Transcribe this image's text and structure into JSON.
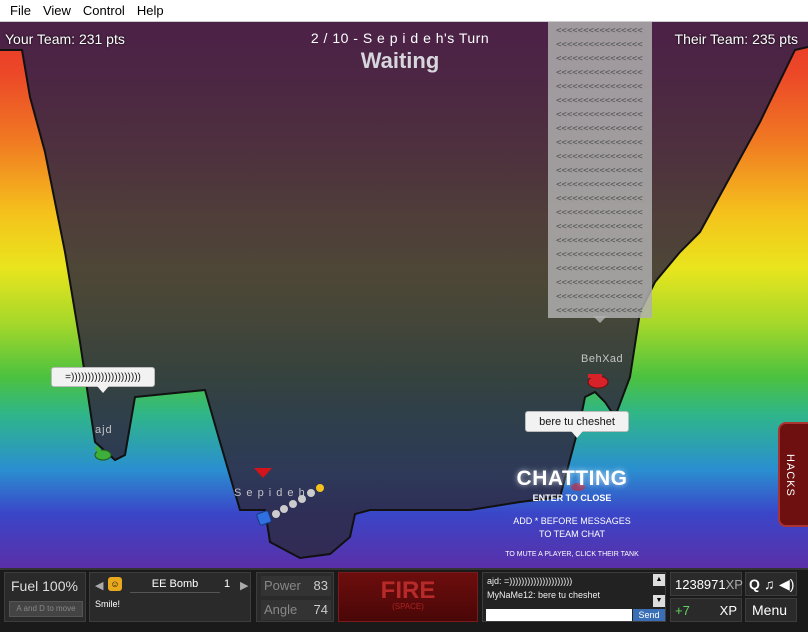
{
  "menubar": {
    "items": [
      "File",
      "View",
      "Control",
      "Help"
    ]
  },
  "hud": {
    "your_team": "Your Team: 231 pts",
    "their_team": "Their Team: 235 pts",
    "turn": "2 / 10 - S e p i d e h's Turn",
    "status": "Waiting"
  },
  "chat_panel": {
    "text": "<<<<<<<<<<<<<<<<<<<<<<<<<<<<<<<<<<<<<<<<<<<<<<<<<<<<<<<<<<<<<<<<<<<<<<<<<<<<<<<<<<<<<<<<<<<<<<<<<<<<<<<<<<<<<<<<<<<<<<<<<<<<<<<<<<<<<<<<<<<<<<<<<<<<<<<<<<<<<<<<<<<<<<<<<<<<<<<<<<<<<<<<<<<<<<<<<<<<<<<<<<<<<<<<<<<<<<<<<<<<<<<<<<<<<<<<<<<<<<<<<<<<<<<<<<<<<<<<<<<<<<<<<<<<<<<<<<<<<<<<<<<<<<<<<<<<<<<<<<<<<<<<<<<<<<<<<<<<<<<<<<<<<<<<<<<<<<<<<<<<<<<<<<<<<<<<<<<<<<<<<<<<<<<"
  },
  "players": {
    "ajd": {
      "name": "ajd",
      "bubble": "=)))))))))))))))))))))"
    },
    "sepideh": {
      "name": "S e p i d e h"
    },
    "behxad": {
      "name": "BehXad",
      "bubble": "bere tu cheshet"
    }
  },
  "hacks": {
    "label": "HACKS"
  },
  "chat_overlay": {
    "title": "CHATTING",
    "close": "ENTER TO CLOSE",
    "hint1": "ADD * BEFORE MESSAGES",
    "hint2": "TO TEAM CHAT",
    "hint3": "TO MUTE A PLAYER, CLICK THEIR TANK"
  },
  "controls": {
    "fuel": "Fuel 100%",
    "fuel_hint": "A and D to move",
    "weapon": "EE Bomb",
    "weapon_count": "1",
    "emote": "Smile!",
    "power_label": "Power",
    "power_value": "83",
    "angle_label": "Angle",
    "angle_value": "74",
    "fire": "FIRE",
    "fire_key": "(SPACE)",
    "chat_line1": "ajd: =)))))))))))))))))))))",
    "chat_line2": "MyNaMe12: bere tu cheshet",
    "send": "Send",
    "xp": "1238971",
    "xp_unit": "XP",
    "xp_gain": "+7",
    "xp_gain_unit": "XP",
    "menu": "Menu"
  },
  "colors": {
    "tank_green": "#3fae3a",
    "tank_blue": "#2f6fe0",
    "tank_red": "#d8222a",
    "fire_bg": "#6d0d0d"
  }
}
